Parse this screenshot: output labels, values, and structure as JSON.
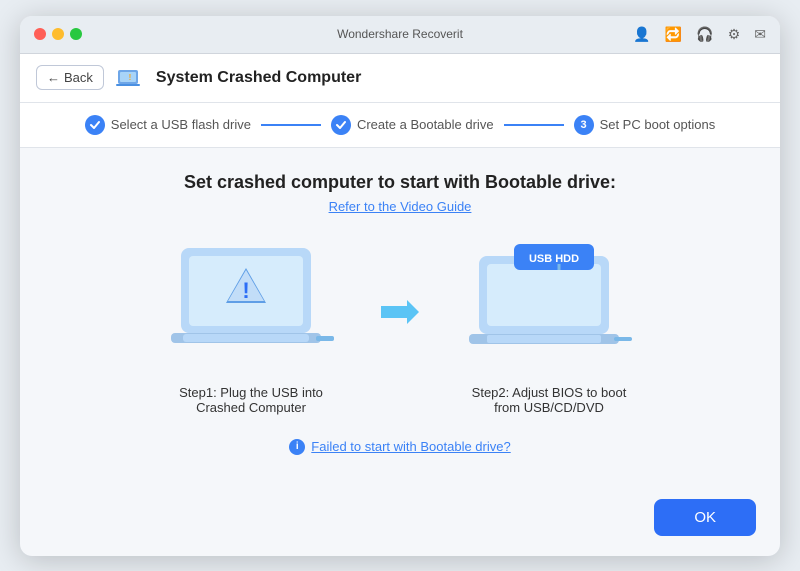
{
  "window": {
    "title": "Wondershare Recoverit"
  },
  "header": {
    "back_label": "Back",
    "title": "System Crashed Computer"
  },
  "steps": [
    {
      "label": "Select a USB flash drive",
      "status": "done",
      "icon": "✓"
    },
    {
      "label": "Create a Bootable drive",
      "status": "done",
      "icon": "✓"
    },
    {
      "label": "Set PC boot options",
      "status": "active",
      "icon": "3"
    }
  ],
  "content": {
    "title": "Set crashed computer to start with Bootable drive:",
    "video_guide": "Refer to the Video Guide",
    "step1": {
      "label": "Step1:  Plug the USB into Crashed Computer"
    },
    "step2": {
      "label": "Step2: Adjust BIOS to boot from USB/CD/DVD"
    },
    "footer_link": "Failed to start with Bootable drive?"
  },
  "footer": {
    "ok_label": "OK"
  }
}
